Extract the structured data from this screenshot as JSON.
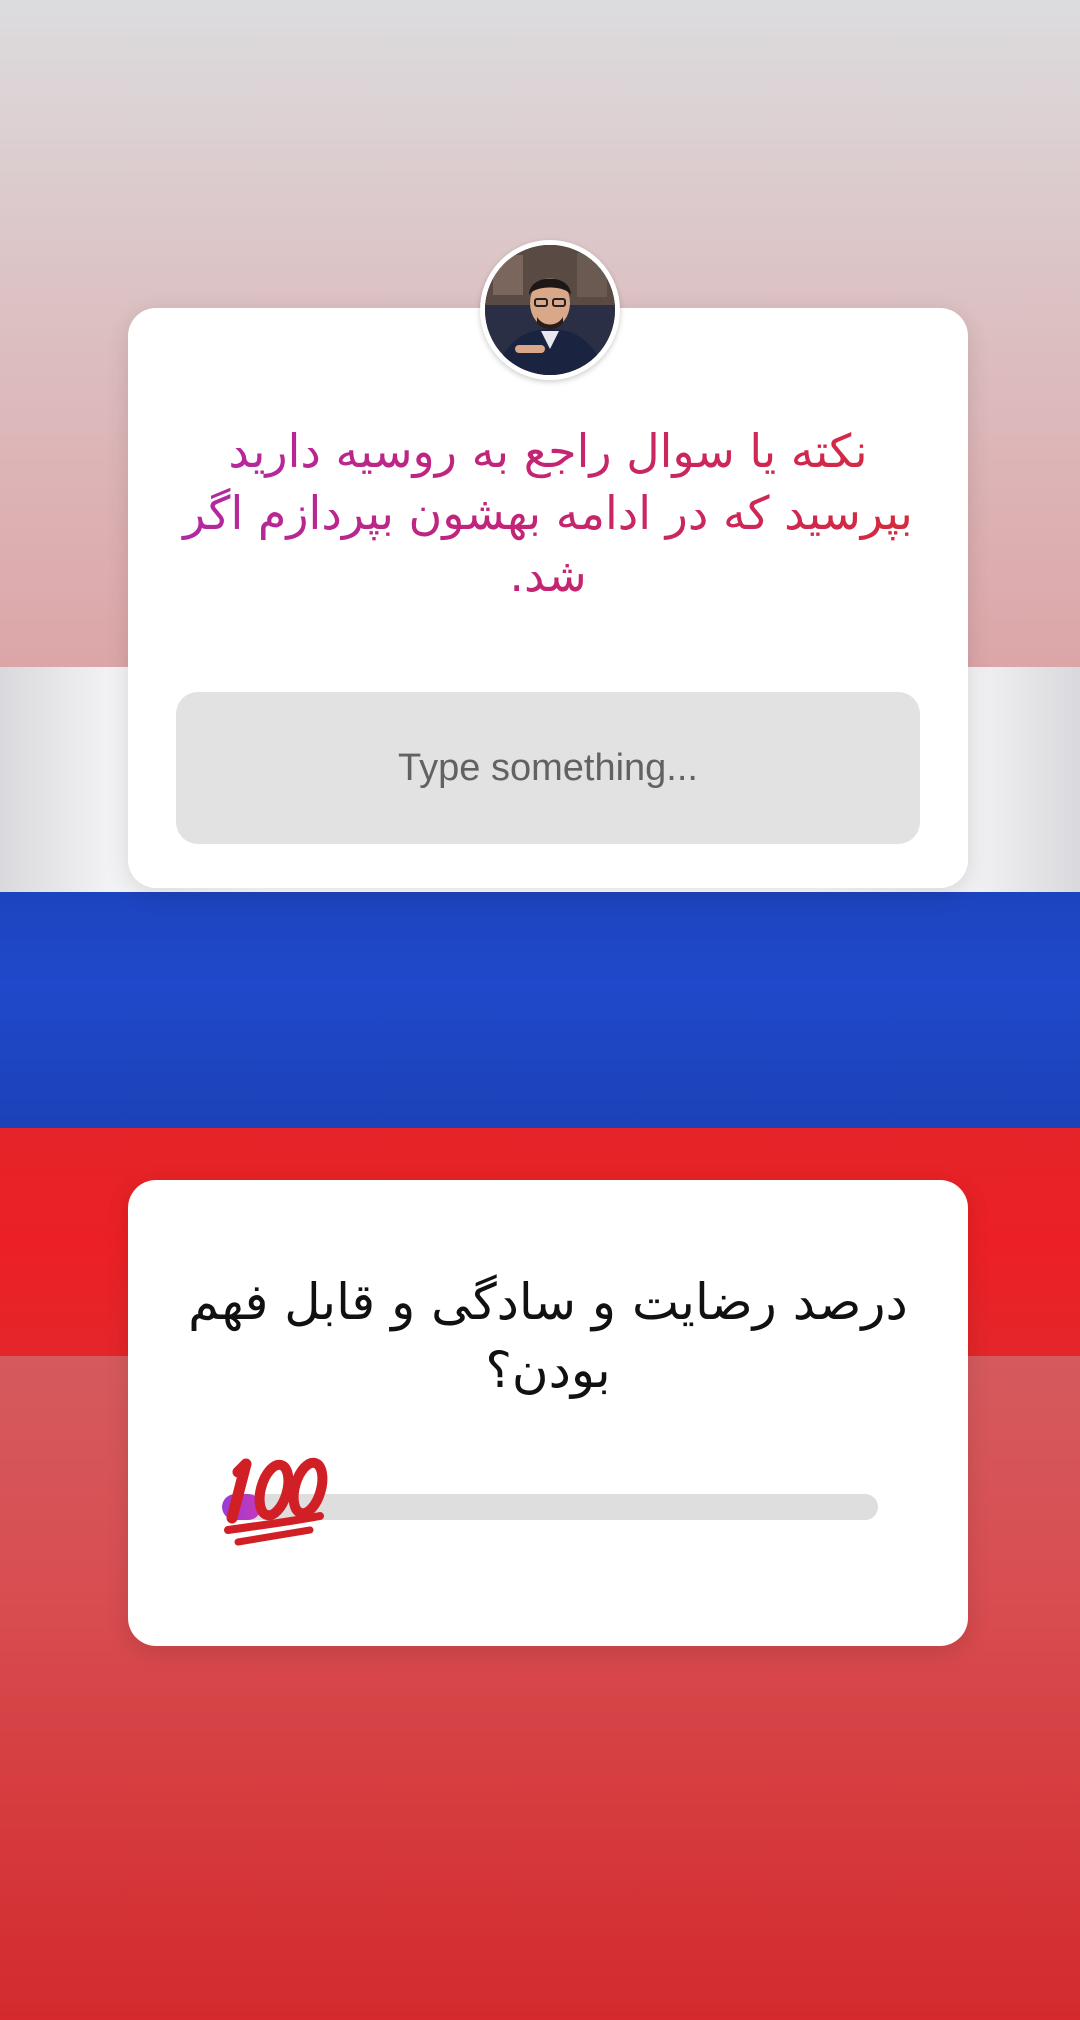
{
  "background": {
    "flag": "russia",
    "colors": {
      "white": "#ffffff",
      "blue": "#1f49ca",
      "red": "#e42428"
    }
  },
  "question_sticker": {
    "avatar_icon": "profile-photo",
    "prompt": "نکته یا سوال راجع به روسیه دارید بپرسید که در ادامه بهشون بپردازم اگر شد.",
    "answer_placeholder": "Type something...",
    "text_gradient": [
      "#b228a4",
      "#d62a3a"
    ]
  },
  "slider_sticker": {
    "question": "درصد رضایت و سادگی و قابل فهم بودن؟",
    "emoji": "💯",
    "emoji_icon": "hundred-points-icon",
    "value_fraction": 0.06,
    "fill_color": "#9b3bd8"
  }
}
